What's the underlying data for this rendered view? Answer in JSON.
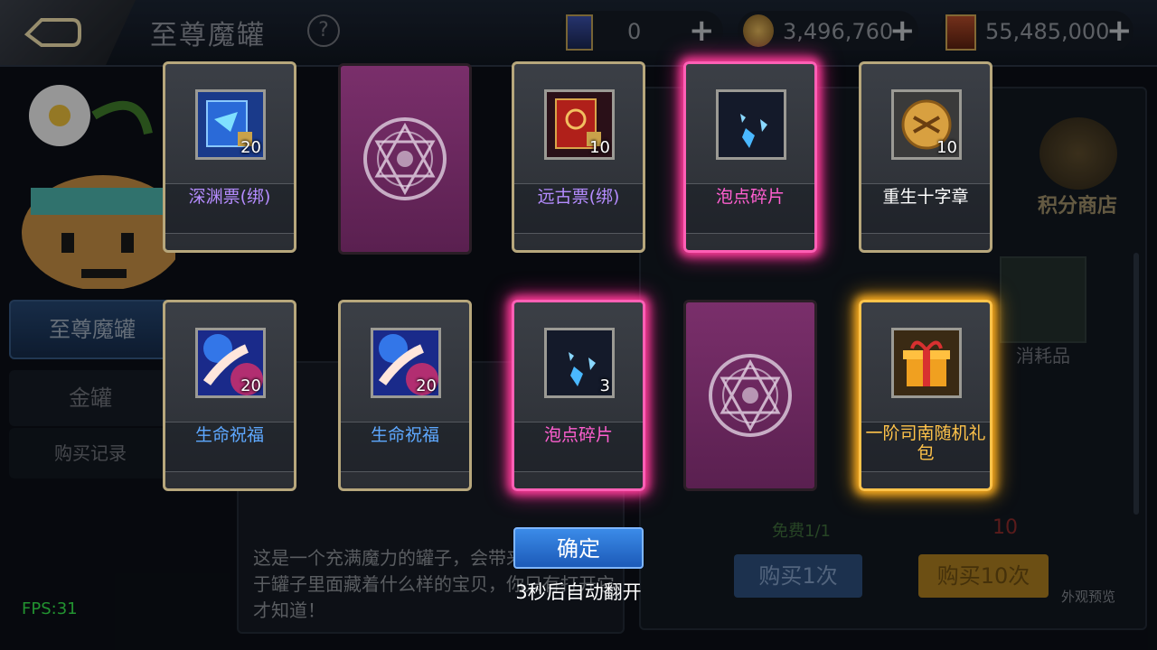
{
  "header": {
    "title": "至尊魔罐",
    "help": "?",
    "resources": [
      {
        "icon": "ticket-card-icon",
        "value": "0"
      },
      {
        "icon": "gold-coin-icon",
        "value": "3,496,760"
      },
      {
        "icon": "scroll-currency-icon",
        "value": "55,485,000"
      }
    ],
    "plus": "+"
  },
  "sidebar": {
    "items": [
      {
        "label": "至尊魔罐"
      },
      {
        "label": "金罐"
      },
      {
        "label": "购买记录"
      }
    ]
  },
  "background": {
    "description": "这是一个充满魔力的罐子，会带来好运气，至于罐子里面藏着什么样的宝贝，你只有打开它才知道！",
    "buy_one": "购买1次",
    "buy_ten": "购买10次",
    "free": "免费1/1",
    "ten_count": "10",
    "shop": "积分商店",
    "consumables": "消耗品",
    "appearance_preview": "外观预览"
  },
  "cards": [
    {
      "type": "face",
      "name": "深渊票(绑)",
      "qty": "20",
      "icon": "abyss-ticket-icon",
      "name_color": "#b58cff",
      "glow": ""
    },
    {
      "type": "back"
    },
    {
      "type": "face",
      "name": "远古票(绑)",
      "qty": "10",
      "icon": "ancient-ticket-icon",
      "name_color": "#b58cff",
      "glow": ""
    },
    {
      "type": "face",
      "name": "泡点碎片",
      "qty": "",
      "icon": "crystal-fragment-icon",
      "name_color": "#ff5fd0",
      "glow": "pink"
    },
    {
      "type": "face",
      "name": "重生十字章",
      "qty": "10",
      "icon": "rebirth-cross-medal-icon",
      "name_color": "#ffffff",
      "glow": ""
    },
    {
      "type": "face",
      "name": "生命祝福",
      "qty": "20",
      "icon": "life-blessing-icon",
      "name_color": "#5ea8ff",
      "glow": ""
    },
    {
      "type": "face",
      "name": "生命祝福",
      "qty": "20",
      "icon": "life-blessing-icon",
      "name_color": "#5ea8ff",
      "glow": ""
    },
    {
      "type": "face",
      "name": "泡点碎片",
      "qty": "3",
      "icon": "crystal-fragment-icon",
      "name_color": "#ff5fd0",
      "glow": "pink"
    },
    {
      "type": "back"
    },
    {
      "type": "face",
      "name": "一阶司南随机礼包",
      "qty": "",
      "icon": "gift-box-icon",
      "name_color": "#ffc34a",
      "glow": "gold"
    }
  ],
  "dialog": {
    "confirm": "确定",
    "countdown": "3秒后自动翻开"
  },
  "fps": "FPS:31"
}
